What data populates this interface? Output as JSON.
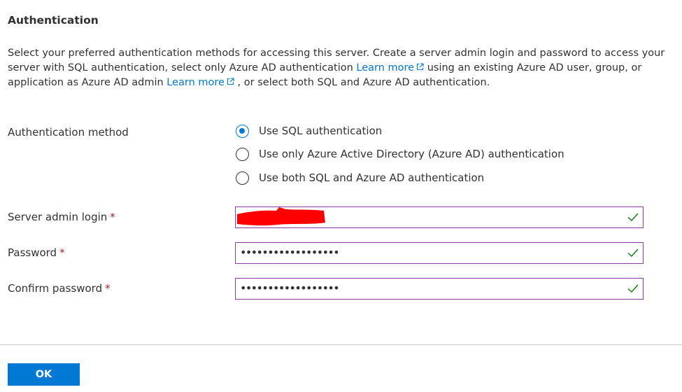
{
  "section": {
    "title": "Authentication",
    "description": {
      "part1": "Select your preferred authentication methods for accessing this server. Create a server admin login and password to access your server with SQL authentication, select only Azure AD authentication ",
      "link1": "Learn more",
      "part2": " using an existing Azure AD user, group, or application as Azure AD admin ",
      "link2": "Learn more",
      "part3": " , or select both SQL and Azure AD authentication."
    }
  },
  "auth_method": {
    "label": "Authentication method",
    "options": [
      {
        "label": "Use SQL authentication",
        "selected": true
      },
      {
        "label": "Use only Azure Active Directory (Azure AD) authentication",
        "selected": false
      },
      {
        "label": "Use both SQL and Azure AD authentication",
        "selected": false
      }
    ]
  },
  "fields": {
    "admin_login": {
      "label": "Server admin login",
      "required_mark": "*",
      "value_redacted": true,
      "valid_icon": "checkmark-icon"
    },
    "password": {
      "label": "Password",
      "required_mark": "*",
      "value": "••••••••••••••••••",
      "valid_icon": "checkmark-icon"
    },
    "confirm_password": {
      "label": "Confirm password",
      "required_mark": "*",
      "value": "••••••••••••••••••",
      "valid_icon": "checkmark-icon"
    }
  },
  "footer": {
    "ok_label": "OK"
  },
  "colors": {
    "accent": "#0078d4",
    "input_border": "#8a3ba1",
    "valid_check": "#107c10",
    "required": "#a4262c",
    "redaction": "#ff0000"
  }
}
